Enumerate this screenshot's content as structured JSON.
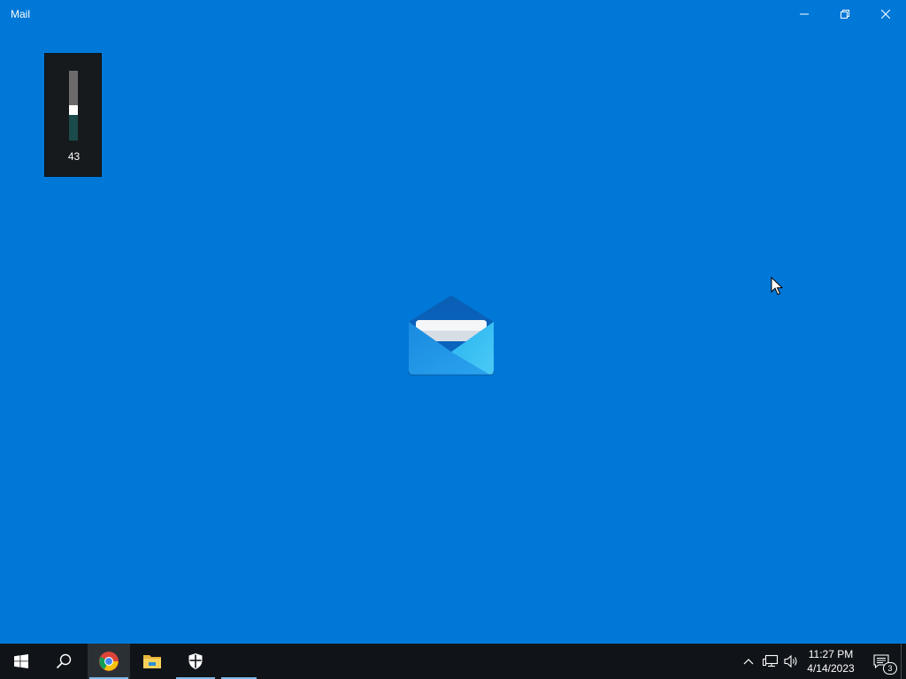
{
  "window": {
    "title": "Mail",
    "buttons": {
      "minimize_icon": "minimize-icon",
      "restore_icon": "restore-icon",
      "close_icon": "close-icon"
    },
    "background_color": "#0078d7"
  },
  "volume_flyout": {
    "level": 43,
    "level_text": "43"
  },
  "splash": {
    "icon": "mail-envelope-icon"
  },
  "taskbar": {
    "pinned": [
      {
        "name": "start",
        "icon": "windows-logo-icon"
      },
      {
        "name": "search",
        "icon": "search-icon"
      },
      {
        "name": "chrome",
        "icon": "chrome-icon",
        "active": true
      },
      {
        "name": "file-explorer",
        "icon": "folder-icon"
      },
      {
        "name": "windows-security",
        "icon": "shield-icon"
      }
    ],
    "tray": {
      "chevron_icon": "chevron-up-icon",
      "network_icon": "network-icon",
      "volume_icon": "speaker-icon"
    },
    "clock": {
      "time": "11:27 PM",
      "date": "4/14/2023"
    },
    "action_center": {
      "icon": "notification-icon",
      "badge": "3"
    }
  }
}
